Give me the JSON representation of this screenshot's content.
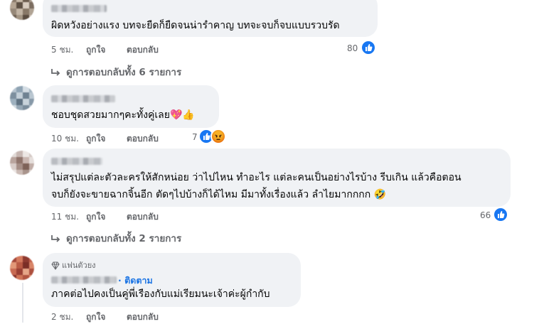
{
  "comments": [
    {
      "text_lines": [
        "ผิดหวังอย่างแรง บทจะยืดก็ยืดจนน่ารำคาญ บทจะจบก็จบแบบรวบรัด"
      ],
      "time": "5 ชม.",
      "like_label": "ถูกใจ",
      "reply_label": "ตอบกลับ",
      "reaction_count": "80",
      "replies_link": "ดูการตอบกลับทั้ง 6 รายการ"
    },
    {
      "text_lines": [
        "ชอบชุดสวยมากๆคะทั้งคู่เลย💖👍"
      ],
      "time": "10 ชม.",
      "like_label": "ถูกใจ",
      "reply_label": "ตอบกลับ",
      "reaction_count": "7"
    },
    {
      "text_lines": [
        "ไม่สรุปแต่ละตัวละครให้สักหน่อย ว่าไปไหน ทำอะไร แต่ละคนเป็นอย่างไรบ้าง รีบเกิน แล้วคือตอน",
        "จบก็ยังจะขายฉากจิ้นอีก ตัดๆไปบ้างก็ได้ไหม มีมาทั้งเรื่องแล้ว ลำไยมากกกก 🤣"
      ],
      "time": "11 ชม.",
      "like_label": "ถูกใจ",
      "reply_label": "ตอบกลับ",
      "reaction_count": "66",
      "replies_link": "ดูการตอบกลับทั้ง 2 รายการ"
    },
    {
      "badge": "แฟนตัวยง",
      "follow_label": "· ติดตาม",
      "text_lines": [
        "ภาคต่อไปคงเป็นคู่พี่เรืองกับแม่เรียมนะเจ้าค่ะผู้กำกับ"
      ],
      "time": "2 ชม.",
      "like_label": "ถูกใจ",
      "reply_label": "ตอบกลับ"
    }
  ],
  "colors": {
    "bubble": "#f0f2f5",
    "meta_text": "#65676b",
    "link_blue": "#1b74e4",
    "like_blue": "#1877f2"
  },
  "icons": [
    "like-reaction-icon",
    "angry-reaction-icon",
    "reply-arrow-icon",
    "diamond-badge-icon"
  ]
}
